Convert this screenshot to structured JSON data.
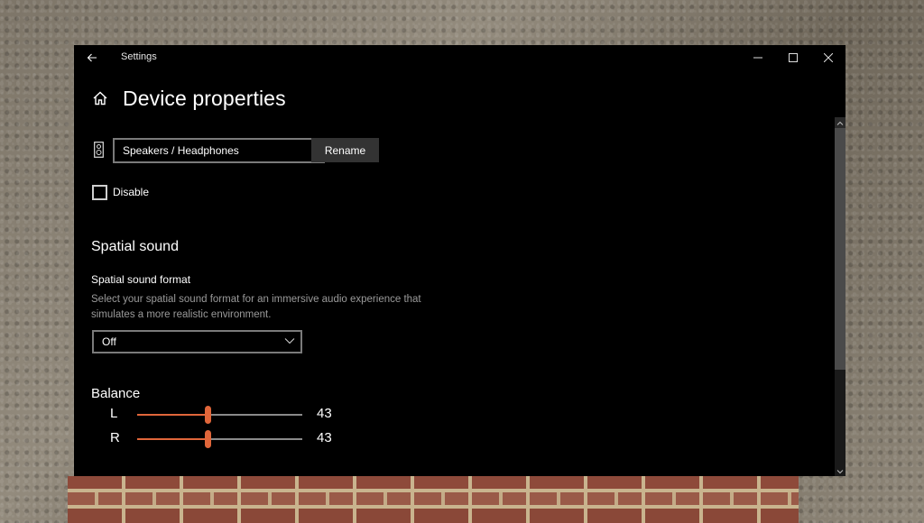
{
  "window": {
    "title": "Settings",
    "controls": {
      "minimize": "minimize-icon",
      "maximize": "maximize-icon",
      "close": "close-icon"
    }
  },
  "header": {
    "back_icon": "back-arrow-icon",
    "home_icon": "home-icon",
    "title": "Device properties"
  },
  "device": {
    "icon": "speaker-icon",
    "name_value": "Speakers / Headphones",
    "rename_label": "Rename",
    "disable_label": "Disable",
    "disable_checked": false
  },
  "spatial_sound": {
    "section_title": "Spatial sound",
    "format_label": "Spatial sound format",
    "description": "Select your spatial sound format for an immersive audio experience that simulates a more realistic environment.",
    "selected": "Off"
  },
  "balance": {
    "title": "Balance",
    "channels": [
      {
        "label": "L",
        "value": "43",
        "level": 43
      },
      {
        "label": "R",
        "value": "43",
        "level": 43
      }
    ],
    "accent_color": "#e0663a"
  },
  "scrollbar": {
    "position_percent": 0,
    "visible_fraction": 0.69
  }
}
